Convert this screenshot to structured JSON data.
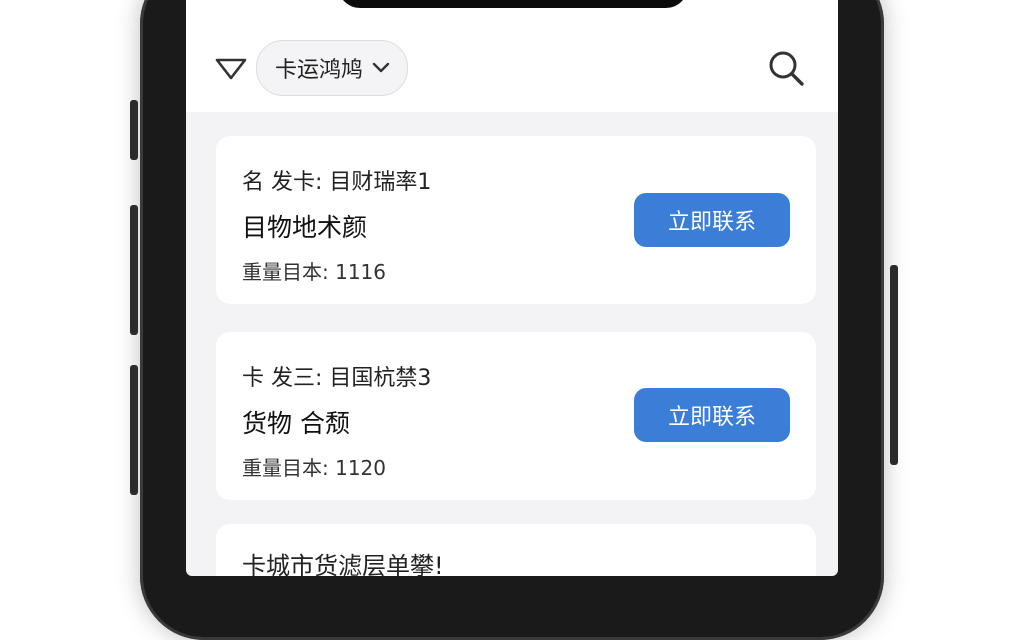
{
  "status_bar": {
    "time": ""
  },
  "header": {
    "city_select": {
      "label": "卡运鸿鸠"
    }
  },
  "cards": [
    {
      "line1": "名 发卡: 目财瑞率1",
      "line2": "目物地术颜",
      "weight": "重量目本: 1116",
      "button_label": "立即联系"
    },
    {
      "line1": "卡 发三: 目国杭禁3",
      "line2": "货物 合颓",
      "weight": "重量目本: 1120",
      "button_label": "立即联系"
    },
    {
      "line1": "卡城市货滤层单攀!"
    }
  ],
  "colors": {
    "accent": "#3b7ed8",
    "background": "#f3f3f5",
    "card": "#ffffff"
  },
  "icons": [
    "filter-icon",
    "chevron-down-icon",
    "search-icon"
  ]
}
